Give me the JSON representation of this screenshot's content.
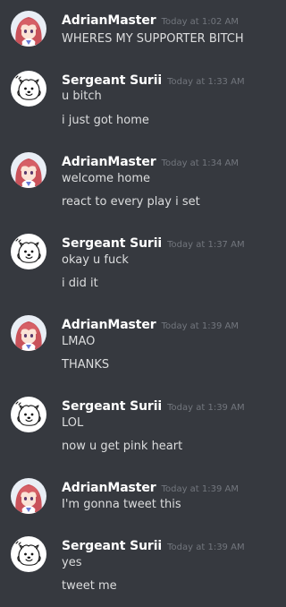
{
  "messages": [
    {
      "author": "AdrianMaster",
      "avatar": "anime-girl-avatar",
      "time": "Today at 1:02 AM",
      "lines": [
        "WHERES MY SUPPORTER BITCH"
      ]
    },
    {
      "author": "Sergeant Surii",
      "avatar": "dog-sketch-avatar",
      "time": "Today at 1:33 AM",
      "lines": [
        "u bitch",
        "i just got home"
      ]
    },
    {
      "author": "AdrianMaster",
      "avatar": "anime-girl-avatar",
      "time": "Today at 1:34 AM",
      "lines": [
        "welcome home",
        "react to every play i set"
      ]
    },
    {
      "author": "Sergeant Surii",
      "avatar": "dog-sketch-avatar",
      "time": "Today at 1:37 AM",
      "lines": [
        "okay u fuck",
        "i did it"
      ]
    },
    {
      "author": "AdrianMaster",
      "avatar": "anime-girl-avatar",
      "time": "Today at 1:39 AM",
      "lines": [
        "LMAO",
        "THANKS"
      ]
    },
    {
      "author": "Sergeant Surii",
      "avatar": "dog-sketch-avatar",
      "time": "Today at 1:39 AM",
      "lines": [
        "LOL",
        "now u get pink heart"
      ]
    },
    {
      "author": "AdrianMaster",
      "avatar": "anime-girl-avatar",
      "time": "Today at 1:39 AM",
      "lines": [
        "I'm gonna tweet this"
      ]
    },
    {
      "author": "Sergeant Surii",
      "avatar": "dog-sketch-avatar",
      "time": "Today at 1:39 AM",
      "lines": [
        "yes",
        "tweet me"
      ]
    }
  ],
  "colors": {
    "background": "#36393f",
    "username": "#ffffff",
    "timestamp": "#72767d",
    "text": "#dcddde"
  }
}
